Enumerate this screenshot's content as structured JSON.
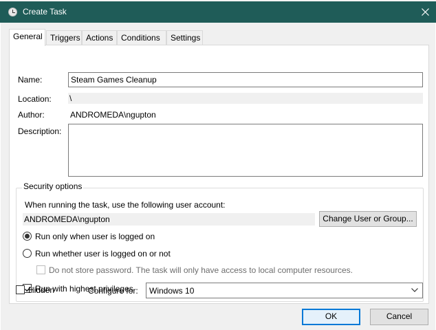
{
  "window": {
    "title": "Create Task"
  },
  "tabs": [
    "General",
    "Triggers",
    "Actions",
    "Conditions",
    "Settings"
  ],
  "general": {
    "name_label": "Name:",
    "name_value": "Steam Games Cleanup",
    "location_label": "Location:",
    "location_value": "\\",
    "author_label": "Author:",
    "author_value": "ANDROMEDA\\ngupton",
    "description_label": "Description:",
    "description_value": ""
  },
  "security": {
    "legend": "Security options",
    "run_as_prompt": "When running the task, use the following user account:",
    "account_value": "ANDROMEDA\\ngupton",
    "change_user_button": "Change User or Group...",
    "radio_logged_on": "Run only when user is logged on",
    "radio_logged_on_or_not": "Run whether user is logged on or not",
    "do_not_store_password": "Do not store password.  The task will only have access to local computer resources.",
    "highest_privileges": "Run with highest privileges",
    "selected_radio": "Run only when user is logged on",
    "highest_privileges_checked": true,
    "do_not_store_checked": false
  },
  "footer": {
    "hidden_label": "Hidden",
    "hidden_checked": false,
    "configure_label": "Configure for:",
    "configure_value": "Windows 10",
    "ok_button": "OK",
    "cancel_button": "Cancel"
  },
  "colors": {
    "titlebar": "#1f5c58",
    "dialog_bg": "#f0f0f0",
    "focus_border": "#0078d7"
  },
  "icons": {
    "title": "task-scheduler-clock-icon",
    "close": "close-icon",
    "dropdown": "chevron-down-icon",
    "check": "checkmark-icon"
  }
}
